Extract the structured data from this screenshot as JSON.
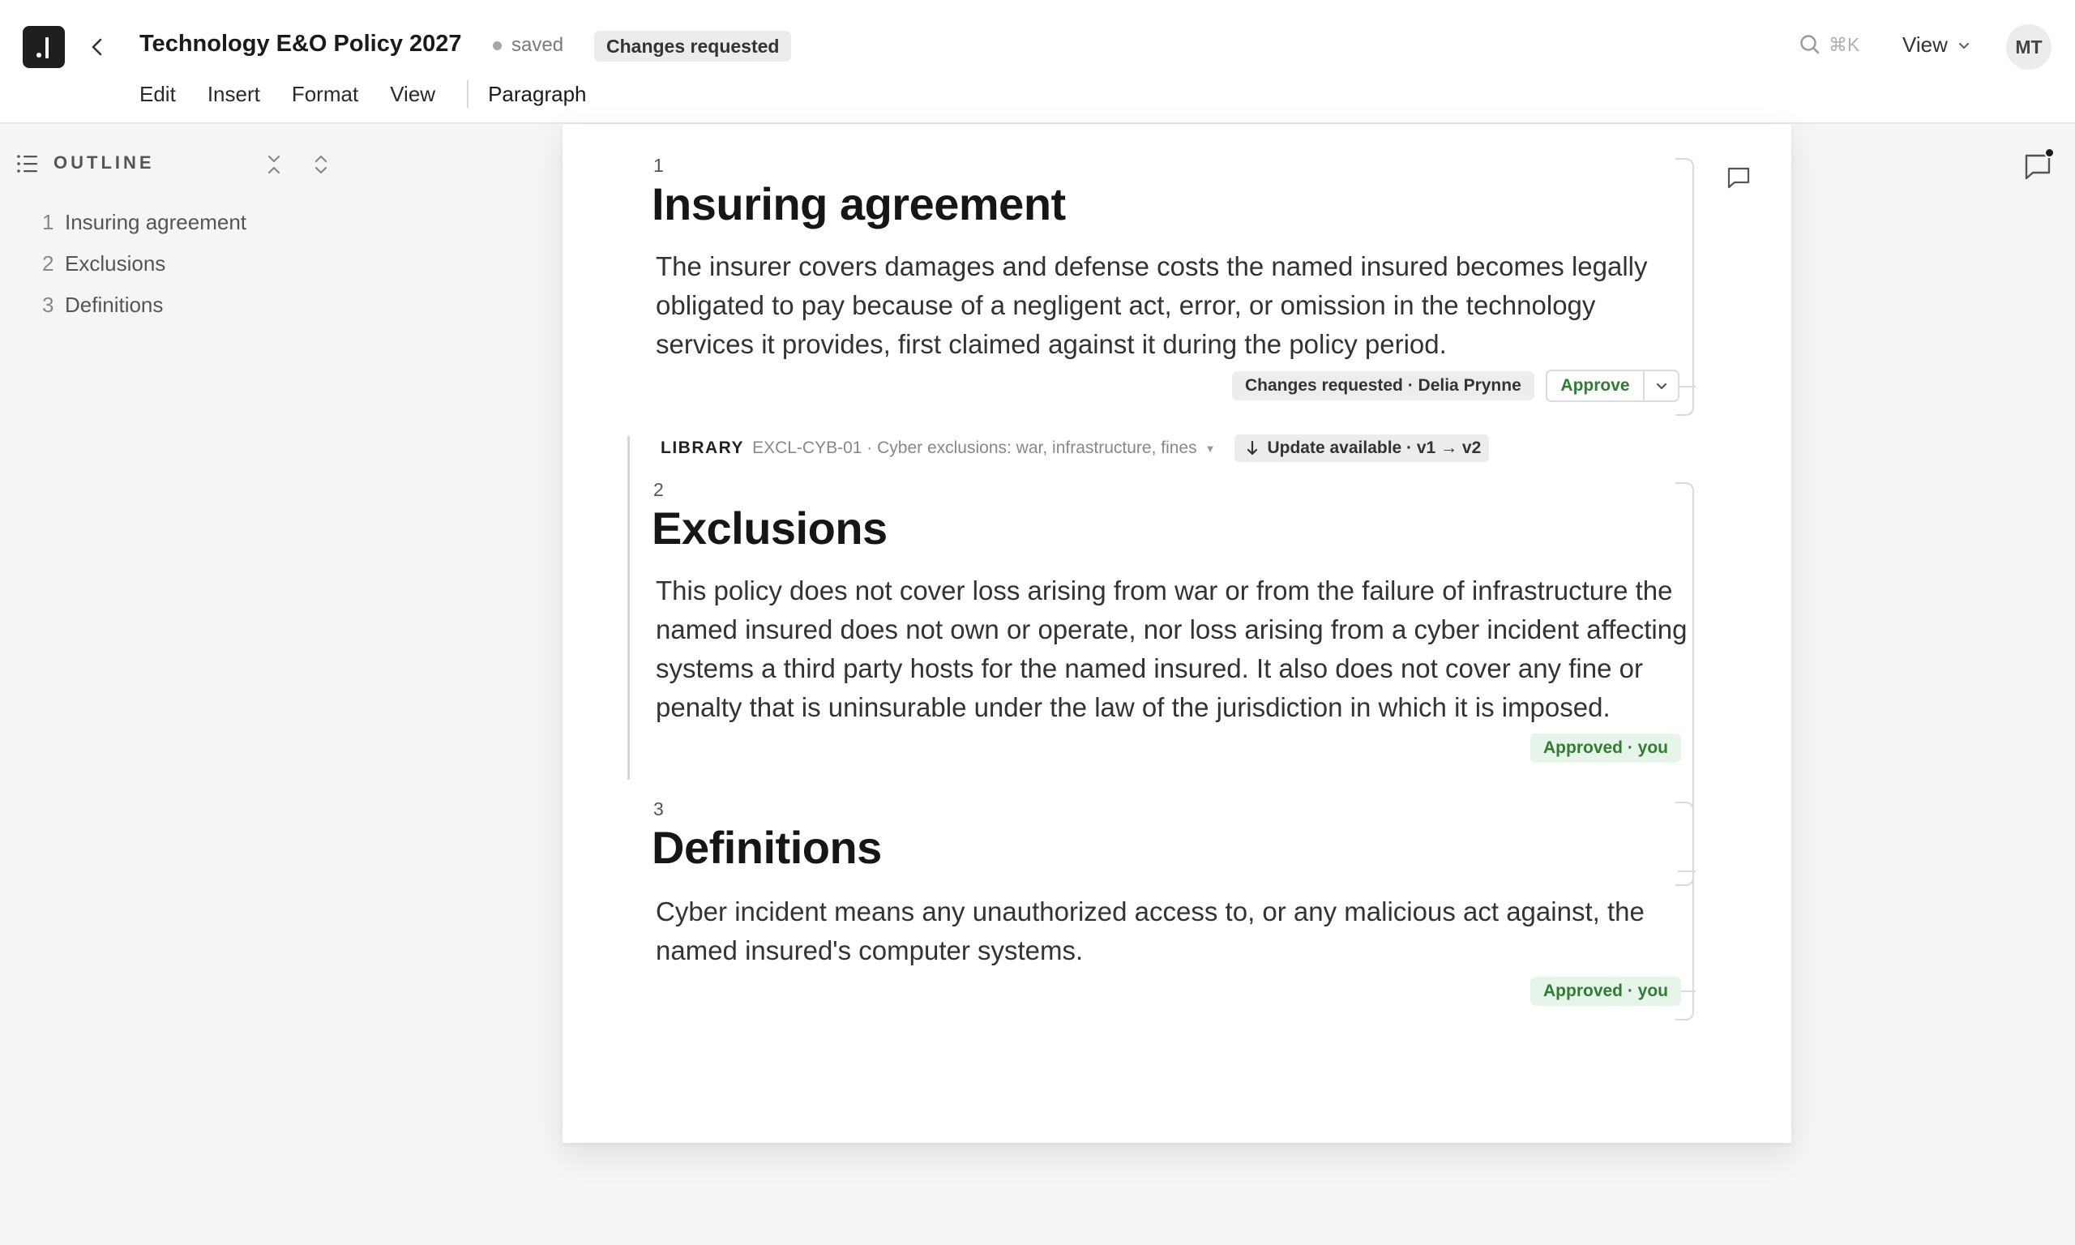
{
  "app": {
    "logo_icon": "app-logo-icon",
    "doc_title": "Technology E&O Policy 2027",
    "save_state": "saved",
    "status": "Changes requested",
    "search_shortcut": "⌘K",
    "view_menu_label": "View",
    "user_initials": "MT"
  },
  "menubar": {
    "edit": "Edit",
    "insert": "Insert",
    "format": "Format",
    "view": "View",
    "block_style": "Paragraph"
  },
  "outline": {
    "title": "OUTLINE",
    "items": [
      {
        "num": "1",
        "label": "Insuring agreement"
      },
      {
        "num": "2",
        "label": "Exclusions"
      },
      {
        "num": "3",
        "label": "Definitions"
      }
    ]
  },
  "sections": [
    {
      "num": "1",
      "heading": "Insuring agreement",
      "body": "The insurer covers damages and defense costs the named insured becomes legally obligated to pay because of a negligent act, error, or omission in the technology services it provides, first claimed against it during the policy period.",
      "status_badge": "Changes requested · Delia Prynne",
      "approve_label": "Approve"
    },
    {
      "num": "2",
      "heading": "Exclusions",
      "body": "This policy does not cover loss arising from war or from the failure of infrastructure the named insured does not own or operate, nor loss arising from a cyber incident affecting systems a third party hosts for the named insured. It also does not cover any fine or penalty that is uninsurable under the law of the jurisdiction in which it is imposed.",
      "status_badge": "Approved · you",
      "library": {
        "label": "LIBRARY",
        "ref": "EXCL-CYB-01 · Cyber exclusions: war, infrastructure, fines",
        "update": "Update available · v1 → v2"
      }
    },
    {
      "num": "3",
      "heading": "Definitions",
      "body": "Cyber incident means any unauthorized access to, or any malicious act against, the named insured's computer systems.",
      "status_badge": "Approved · you"
    }
  ],
  "colors": {
    "accent_green": "#2e7d32",
    "approved_bg": "#e6f4ea",
    "pill_gray": "#ececec"
  }
}
